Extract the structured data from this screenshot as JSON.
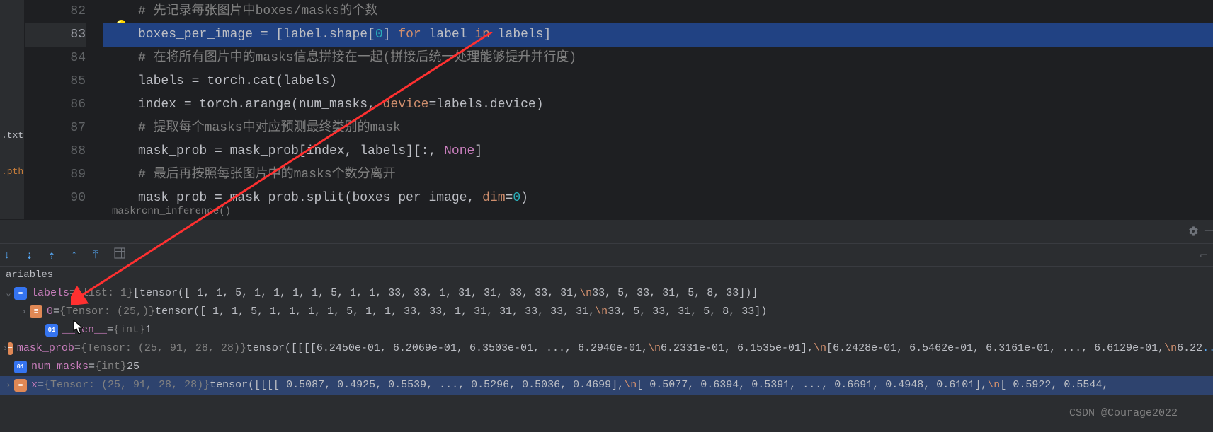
{
  "editor": {
    "files": {
      "txt": ".txt",
      "pth": ".pth"
    },
    "lines": [
      {
        "num": "82",
        "type": "comment",
        "indent": 50,
        "text": "# 先记录每张图片中boxes/masks的个数"
      },
      {
        "num": "83",
        "type": "highlighted",
        "indent": 50,
        "tokens": [
          {
            "t": "boxes_per_image ",
            "c": "identifier"
          },
          {
            "t": "= [label.shape[",
            "c": "identifier"
          },
          {
            "t": "0",
            "c": "hl-num"
          },
          {
            "t": "] ",
            "c": "identifier"
          },
          {
            "t": "for",
            "c": "hl-kw"
          },
          {
            "t": " label ",
            "c": "identifier"
          },
          {
            "t": "in",
            "c": "hl-kw"
          },
          {
            "t": " labels]",
            "c": "identifier"
          }
        ]
      },
      {
        "num": "84",
        "type": "comment",
        "indent": 50,
        "text": "# 在将所有图片中的masks信息拼接在一起(拼接后统一处理能够提升并行度)"
      },
      {
        "num": "85",
        "type": "code",
        "indent": 50,
        "tokens": [
          {
            "t": "labels",
            "c": "identifier"
          },
          {
            "t": " = torch.cat(",
            "c": "identifier"
          },
          {
            "t": "labels",
            "c": "identifier"
          },
          {
            "t": ")",
            "c": "identifier"
          }
        ]
      },
      {
        "num": "86",
        "type": "code",
        "indent": 50,
        "tokens": [
          {
            "t": "index ",
            "c": "identifier"
          },
          {
            "t": "= torch.arange(num_masks, ",
            "c": "identifier"
          },
          {
            "t": "device",
            "c": "keyword"
          },
          {
            "t": "=labels.device)",
            "c": "identifier"
          }
        ]
      },
      {
        "num": "87",
        "type": "comment",
        "indent": 50,
        "text": "# 提取每个masks中对应预测最终类别的mask"
      },
      {
        "num": "88",
        "type": "code",
        "indent": 50,
        "tokens": [
          {
            "t": "mask_prob = mask_prob[index, ",
            "c": "identifier"
          },
          {
            "t": "labels",
            "c": "identifier"
          },
          {
            "t": "][:, ",
            "c": "identifier"
          },
          {
            "t": "None",
            "c": "builtin"
          },
          {
            "t": "]",
            "c": "identifier"
          }
        ]
      },
      {
        "num": "89",
        "type": "comment",
        "indent": 50,
        "text": "# 最后再按照每张图片中的masks个数分离开"
      },
      {
        "num": "90",
        "type": "code",
        "indent": 50,
        "tokens": [
          {
            "t": "mask_prob = mask_prob.split(boxes_per_image, ",
            "c": "identifier"
          },
          {
            "t": "dim",
            "c": "keyword"
          },
          {
            "t": "=",
            "c": "identifier"
          },
          {
            "t": "0",
            "c": "number"
          },
          {
            "t": ")",
            "c": "identifier"
          }
        ]
      }
    ],
    "breadcrumb": "maskrcnn_inference()"
  },
  "toolbar": {
    "variables_label": "ariables"
  },
  "variables": [
    {
      "indent": 0,
      "chevron": "down",
      "icon": "list",
      "icon_text": "≡",
      "name": "labels",
      "type": "{list: 1}",
      "value_parts": [
        {
          "t": " [tensor([ 1,  1,  5,  1,  1,  1,  1,  5,  1,  1, 33, 33,  1, 31, 31, 33, 33, 31,",
          "c": "var-value"
        },
        {
          "t": "\\n",
          "c": "var-newline"
        },
        {
          "t": "        33,  5, 33, 31,  5,  8, 33])]",
          "c": "var-value"
        }
      ]
    },
    {
      "indent": 1,
      "chevron": "right",
      "icon": "obj",
      "icon_text": "≡",
      "name": "0",
      "type": "{Tensor: (25,)}",
      "value_parts": [
        {
          "t": " tensor([ 1,  1,  5,  1,  1,  1,  1,  5,  1,  1, 33, 33,  1, 31, 31, 33, 33, 31,",
          "c": "var-value"
        },
        {
          "t": "\\n",
          "c": "var-newline"
        },
        {
          "t": "        33,  5, 33, 31,  5,  8, 33])",
          "c": "var-value"
        }
      ]
    },
    {
      "indent": 2,
      "chevron": "",
      "icon": "int",
      "icon_text": "01",
      "name": "__len__",
      "type": "{int}",
      "value_parts": [
        {
          "t": " 1",
          "c": "var-value"
        }
      ]
    },
    {
      "indent": 0,
      "chevron": "right",
      "icon": "obj",
      "icon_text": "≡",
      "name": "mask_prob",
      "type": "{Tensor: (25, 91, 28, 28)}",
      "value_parts": [
        {
          "t": " tensor([[[[6.2450e-01, 6.2069e-01, 6.3503e-01,  ..., 6.2940e-01,",
          "c": "var-value"
        },
        {
          "t": "\\n",
          "c": "var-newline"
        },
        {
          "t": "           6.2331e-01, 6.1535e-01],",
          "c": "var-value"
        },
        {
          "t": "\\n",
          "c": "var-newline"
        },
        {
          "t": "          [6.2428e-01, 6.5462e-01, 6.3161e-01,  ..., 6.6129e-01,",
          "c": "var-value"
        },
        {
          "t": "\\n",
          "c": "var-newline"
        },
        {
          "t": "           6.22",
          "c": "var-value"
        }
      ],
      "view": "... View"
    },
    {
      "indent": 0,
      "chevron": "",
      "icon": "int",
      "icon_text": "01",
      "name": "num_masks",
      "type": "{int}",
      "value_parts": [
        {
          "t": " 25",
          "c": "var-value"
        }
      ]
    },
    {
      "indent": 0,
      "chevron": "right",
      "icon": "obj",
      "icon_text": "≡",
      "selected": true,
      "name": "x",
      "type": "{Tensor: (25, 91, 28, 28)}",
      "value_parts": [
        {
          "t": " tensor([[[[ 0.5087,  0.4925,  0.5539,  ...,  0.5296,  0.5036,  0.4699],",
          "c": "var-value"
        },
        {
          "t": "\\n",
          "c": "var-newline"
        },
        {
          "t": "          [ 0.5077,  0.6394,  0.5391,  ...,  0.6691,  0.4948,  0.6101],",
          "c": "var-value"
        },
        {
          "t": "\\n",
          "c": "var-newline"
        },
        {
          "t": "          [ 0.5922,  0.5544,",
          "c": "var-value"
        }
      ]
    }
  ],
  "watermark": "CSDN @Courage2022"
}
